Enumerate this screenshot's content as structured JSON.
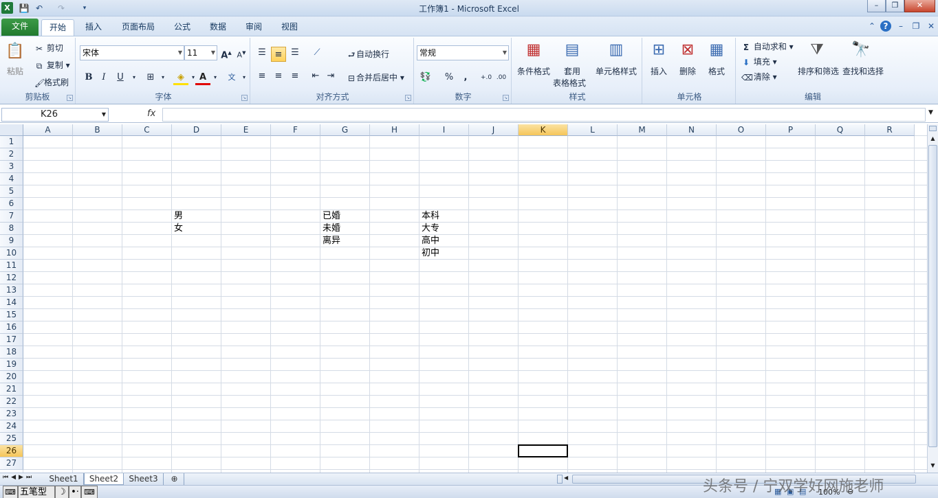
{
  "window": {
    "title": "工作簿1 - Microsoft Excel",
    "minimize": "–",
    "restore": "❐",
    "close": "✕"
  },
  "ribbon_tabs": [
    "文件",
    "开始",
    "插入",
    "页面布局",
    "公式",
    "数据",
    "审阅",
    "视图"
  ],
  "clipboard": {
    "paste": "粘贴",
    "cut": "剪切",
    "copy": "复制",
    "format_painter": "格式刷",
    "label": "剪贴板"
  },
  "font": {
    "name": "宋体",
    "size": "11",
    "label": "字体",
    "bold": "B",
    "italic": "I",
    "underline": "U"
  },
  "alignment": {
    "wrap_text": "自动换行",
    "merge_center": "合并后居中",
    "label": "对齐方式"
  },
  "number": {
    "format": "常规",
    "label": "数字",
    "percent": "%",
    "comma": ","
  },
  "styles": {
    "conditional": "条件格式",
    "table_line1": "套用",
    "table_line2": "表格格式",
    "cell_styles": "单元格样式",
    "label": "样式"
  },
  "cells_group": {
    "insert": "插入",
    "delete": "删除",
    "format": "格式",
    "label": "单元格"
  },
  "editing": {
    "autosum": "自动求和",
    "fill": "填充",
    "clear": "清除",
    "sort_filter": "排序和筛选",
    "find_select": "查找和选择",
    "label": "编辑"
  },
  "formula_bar": {
    "name_box": "K26",
    "fx": "fx",
    "content": ""
  },
  "columns": [
    "A",
    "B",
    "C",
    "D",
    "E",
    "F",
    "G",
    "H",
    "I",
    "J",
    "K",
    "L",
    "M",
    "N",
    "O",
    "P",
    "Q",
    "R"
  ],
  "rows": [
    "1",
    "2",
    "3",
    "4",
    "5",
    "6",
    "7",
    "8",
    "9",
    "10",
    "11",
    "12",
    "13",
    "14",
    "15",
    "16",
    "17",
    "18",
    "19",
    "20",
    "21",
    "22",
    "23",
    "24",
    "25",
    "26",
    "27"
  ],
  "selected": {
    "column": "K",
    "row": "26"
  },
  "cells": {
    "D7": "男",
    "D8": "女",
    "G7": "已婚",
    "G8": "未婚",
    "G9": "离异",
    "I7": "本科",
    "I8": "大专",
    "I9": "高中",
    "I10": "初中"
  },
  "sheets": [
    "Sheet1",
    "Sheet2",
    "Sheet3"
  ],
  "active_sheet": "Sheet2",
  "status": {
    "ime": "五笔型",
    "zoom": "100%"
  },
  "watermark": "头条号 / 宁双学好网施老师"
}
